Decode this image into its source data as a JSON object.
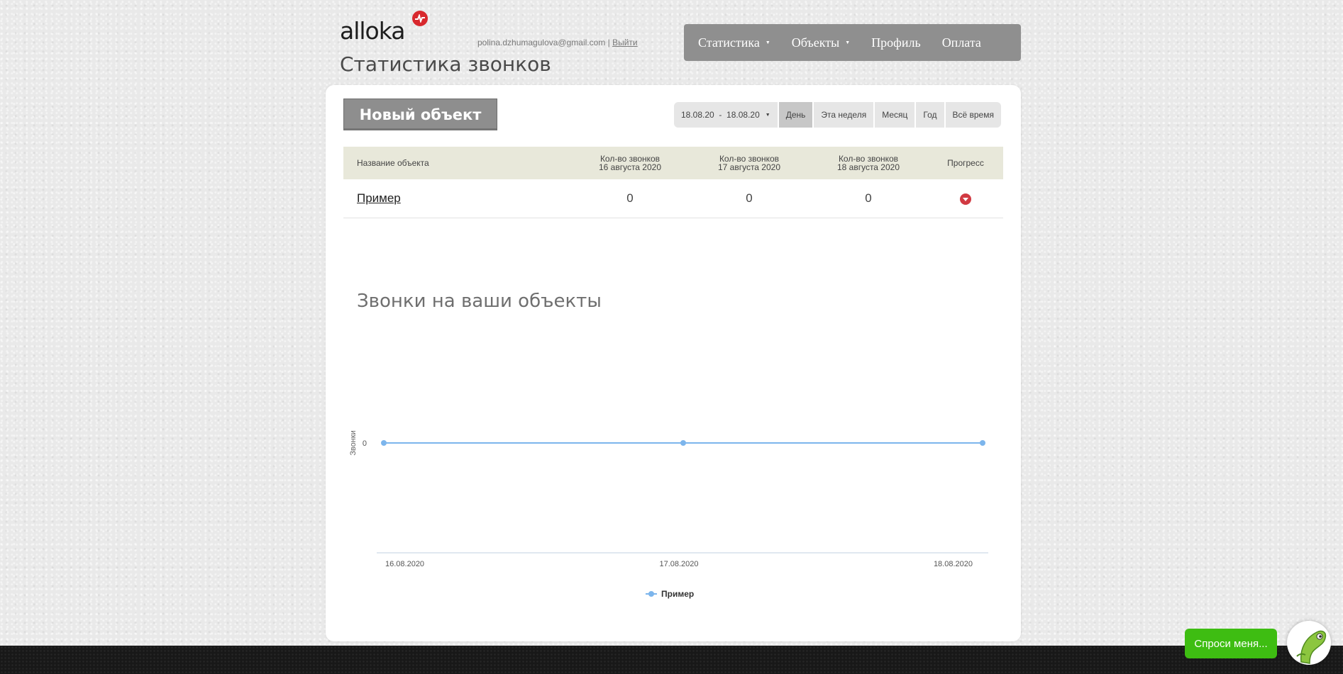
{
  "header": {
    "logo_text": "alloka",
    "user_email": "polina.dzhumagulova@gmail.com",
    "separator": "|",
    "logout_label": "Выйти",
    "page_title": "Статистика звонков"
  },
  "nav": {
    "items": [
      {
        "label": "Статистика",
        "has_menu": true
      },
      {
        "label": "Объекты",
        "has_menu": true
      },
      {
        "label": "Профиль",
        "has_menu": false
      },
      {
        "label": "Оплата",
        "has_menu": false
      }
    ]
  },
  "toolbar": {
    "new_object_label": "Новый объект",
    "date_range": "18.08.20  -  18.08.20",
    "periods": [
      "День",
      "Эта неделя",
      "Месяц",
      "Год",
      "Всё время"
    ],
    "active_period": "День"
  },
  "table": {
    "headers": {
      "name": "Название объекта",
      "col1_line1": "Кол-во звонков",
      "col1_line2": "16 августа 2020",
      "col2_line1": "Кол-во звонков",
      "col2_line2": "17 августа 2020",
      "col3_line1": "Кол-во звонков",
      "col3_line2": "18 августа 2020",
      "progress": "Прогресс"
    },
    "rows": [
      {
        "name": "Пример",
        "v1": "0",
        "v2": "0",
        "v3": "0",
        "progress": "down"
      }
    ]
  },
  "chart_data": {
    "type": "line",
    "title": "Звонки на ваши объекты",
    "xlabel": "",
    "ylabel": "Звонки",
    "categories": [
      "16.08.2020",
      "17.08.2020",
      "18.08.2020"
    ],
    "y_ticks": [
      "0"
    ],
    "series": [
      {
        "name": "Пример",
        "values": [
          0,
          0,
          0
        ],
        "color": "#7cb5ec"
      }
    ],
    "legend": "bottom-center",
    "grid": false
  },
  "widget": {
    "ask_label": "Спроси меня..."
  },
  "colors": {
    "nav_bg": "#8f8f8f",
    "table_header_bg": "#e8e8da",
    "progress_down": "#d13a42",
    "ask_button": "#3ebd12",
    "series": "#7cb5ec"
  }
}
